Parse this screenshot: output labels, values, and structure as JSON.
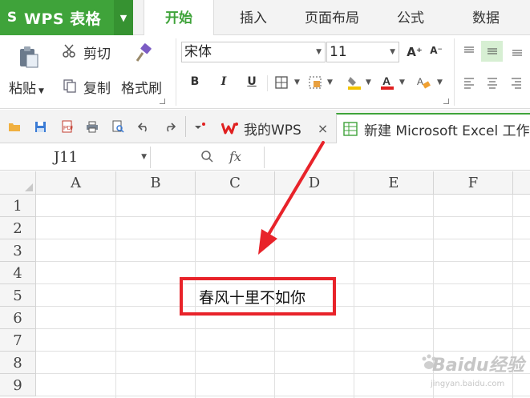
{
  "app": {
    "logo": "S",
    "title": "WPS 表格",
    "menu_caret": "▼"
  },
  "ribbon_tabs": [
    {
      "label": "开始",
      "active": true
    },
    {
      "label": "插入",
      "active": false
    },
    {
      "label": "页面布局",
      "active": false
    },
    {
      "label": "公式",
      "active": false
    },
    {
      "label": "数据",
      "active": false
    }
  ],
  "clipboard": {
    "paste_label": "粘贴",
    "cut_label": "剪切",
    "copy_label": "复制",
    "format_painter_label": "格式刷"
  },
  "font": {
    "name": "宋体",
    "size": "11",
    "bold": "B",
    "italic": "I",
    "underline": "U",
    "grow": "A⁺",
    "shrink": "A⁻"
  },
  "doc_tabs": [
    {
      "label": "我的WPS",
      "close": "×"
    },
    {
      "label": "新建 Microsoft Excel 工作"
    }
  ],
  "formula_bar": {
    "cell_ref": "J11",
    "fx": "fx"
  },
  "sheet": {
    "columns": [
      "A",
      "B",
      "C",
      "D",
      "E",
      "F"
    ],
    "rows": [
      "1",
      "2",
      "3",
      "4",
      "5",
      "6",
      "7",
      "8",
      "9"
    ],
    "cell_c5": "春风十里不如你"
  },
  "annotation": {
    "arrow_color": "#e8232a",
    "box_color": "#e8232a"
  },
  "watermark": {
    "text": "Baidu经验",
    "sub": "jingyan.baidu.com"
  },
  "colors": {
    "brand_green": "#3fa33a"
  }
}
